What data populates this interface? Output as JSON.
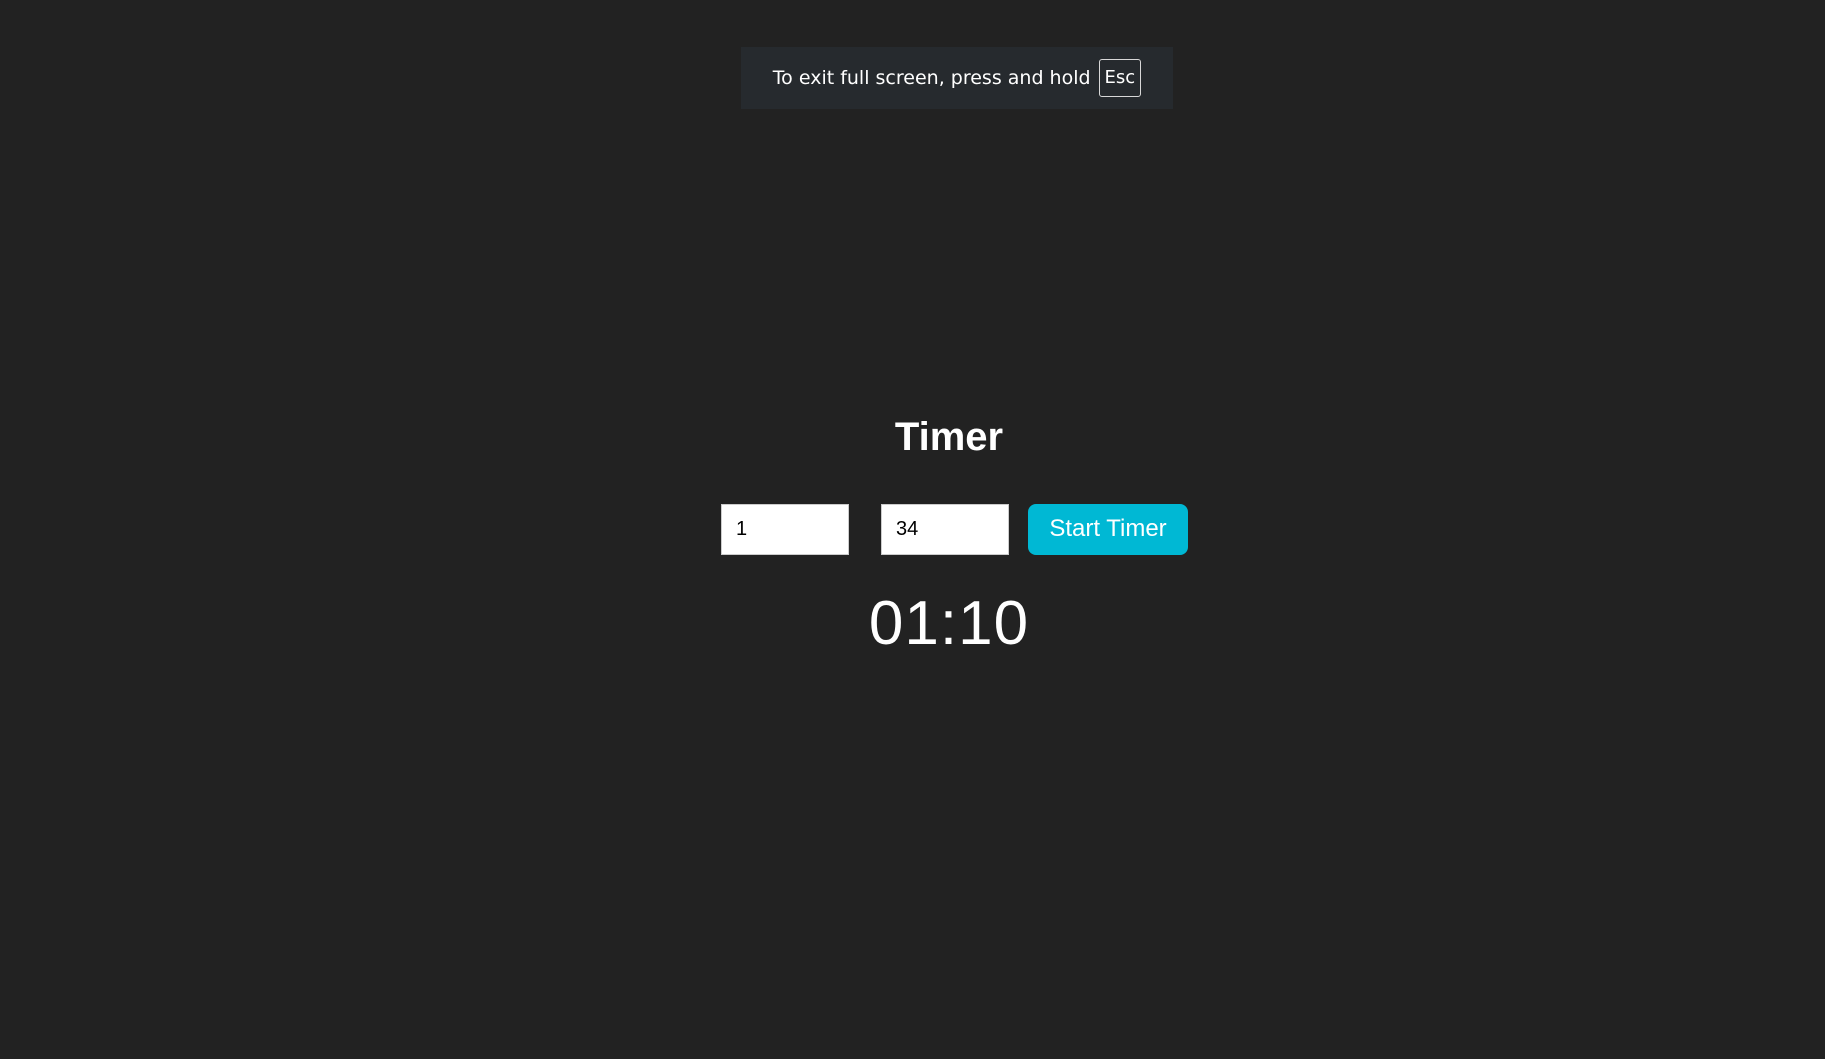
{
  "fullscreen_notice": {
    "message": "To exit full screen, press and hold",
    "key": "Esc"
  },
  "timer": {
    "title": "Timer",
    "minutes_value": "1",
    "seconds_value": "34",
    "start_label": "Start Timer",
    "display": "01:10"
  },
  "colors": {
    "background": "#222222",
    "accent": "#00b8d4",
    "toast_background": "#262a2e",
    "text": "#ffffff"
  }
}
